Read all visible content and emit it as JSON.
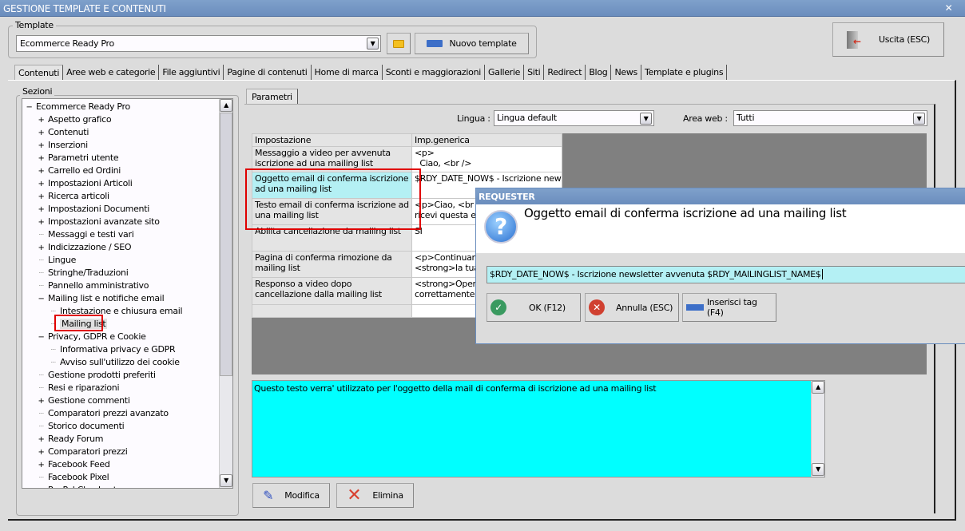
{
  "window": {
    "title": "GESTIONE TEMPLATE E CONTENUTI",
    "close": "✕"
  },
  "template": {
    "legend": "Template",
    "value": "Ecommerce Ready Pro",
    "new_label": "Nuovo template"
  },
  "exit_label": "Uscita (ESC)",
  "tabs": [
    "Contenuti",
    "Aree web e categorie",
    "File aggiuntivi",
    "Pagine di contenuti",
    "Home di marca",
    "Sconti e maggiorazioni",
    "Gallerie",
    "Siti",
    "Redirect",
    "Blog",
    "News",
    "Template e plugins"
  ],
  "sections": {
    "legend": "Sezioni",
    "items": [
      {
        "label": "Ecommerce Ready Pro",
        "level": 0,
        "toggle": "−"
      },
      {
        "label": "Aspetto grafico",
        "level": 1,
        "toggle": "+"
      },
      {
        "label": "Contenuti",
        "level": 1,
        "toggle": "+"
      },
      {
        "label": "Inserzioni",
        "level": 1,
        "toggle": "+"
      },
      {
        "label": "Parametri utente",
        "level": 1,
        "toggle": "+"
      },
      {
        "label": "Carrello ed Ordini",
        "level": 1,
        "toggle": "+"
      },
      {
        "label": "Impostazioni Articoli",
        "level": 1,
        "toggle": "+"
      },
      {
        "label": "Ricerca articoli",
        "level": 1,
        "toggle": "+"
      },
      {
        "label": "Impostazioni Documenti",
        "level": 1,
        "toggle": "+"
      },
      {
        "label": "Impostazioni avanzate sito",
        "level": 1,
        "toggle": "+"
      },
      {
        "label": "Messaggi e testi vari",
        "level": 1,
        "toggle": ""
      },
      {
        "label": "Indicizzazione / SEO",
        "level": 1,
        "toggle": "+"
      },
      {
        "label": "Lingue",
        "level": 1,
        "toggle": ""
      },
      {
        "label": "Stringhe/Traduzioni",
        "level": 1,
        "toggle": ""
      },
      {
        "label": "Pannello amministrativo",
        "level": 1,
        "toggle": ""
      },
      {
        "label": "Mailing list e notifiche email",
        "level": 1,
        "toggle": "−"
      },
      {
        "label": "Intestazione e chiusura email",
        "level": 2,
        "toggle": ""
      },
      {
        "label": "Mailing list",
        "level": 2,
        "toggle": "",
        "selected": true
      },
      {
        "label": "Privacy, GDPR e Cookie",
        "level": 1,
        "toggle": "−"
      },
      {
        "label": "Informativa privacy e GDPR",
        "level": 2,
        "toggle": ""
      },
      {
        "label": "Avviso sull'utilizzo dei cookie",
        "level": 2,
        "toggle": ""
      },
      {
        "label": "Gestione prodotti preferiti",
        "level": 1,
        "toggle": ""
      },
      {
        "label": "Resi e riparazioni",
        "level": 1,
        "toggle": ""
      },
      {
        "label": "Gestione commenti",
        "level": 1,
        "toggle": "+"
      },
      {
        "label": "Comparatori prezzi avanzato",
        "level": 1,
        "toggle": ""
      },
      {
        "label": "Storico documenti",
        "level": 1,
        "toggle": ""
      },
      {
        "label": "Ready Forum",
        "level": 1,
        "toggle": "+"
      },
      {
        "label": "Comparatori prezzi",
        "level": 1,
        "toggle": "+"
      },
      {
        "label": "Facebook Feed",
        "level": 1,
        "toggle": "+"
      },
      {
        "label": "Facebook Pixel",
        "level": 1,
        "toggle": ""
      },
      {
        "label": "PayPal Checkout",
        "level": 1,
        "toggle": ""
      }
    ]
  },
  "params": {
    "tab": "Parametri",
    "lingua_label": "Lingua :",
    "lingua_value": "Lingua default",
    "area_label": "Area web :",
    "area_value": "Tutti",
    "columns": [
      "Impostazione",
      "Imp.generica"
    ],
    "rows": [
      [
        "Messaggio a video per avvenuta iscrizione ad una mailing list",
        "<p>\n  Ciao, <br />"
      ],
      [
        "Oggetto email di conferma iscrizione ad una mailing list",
        "$RDY_DATE_NOW$ - Iscrizione newsletter avvenuta $RDY_MAILI"
      ],
      [
        "Testo email di conferma iscrizione ad una mailing list",
        "<p>Ciao, <br />\nricevi questa email"
      ],
      [
        "Abilita cancellazione da mailing list",
        "SI"
      ],
      [
        "Pagina di conferma rimozione da mailing list",
        "<p>Continuando\n<strong>la tua"
      ],
      [
        "Responso a video dopo cancellazione dalla mailing list",
        "<strong>Operazione\ncorrettamente! <"
      ],
      [
        "",
        ""
      ]
    ],
    "description": "Questo testo verra' utilizzato per l'oggetto della mail di conferma di iscrizione ad una mailing list",
    "edit_label": "Modifica",
    "delete_label": "Elimina"
  },
  "dialog": {
    "title": "REQUESTER",
    "question": "Oggetto email di conferma iscrizione ad una mailing list",
    "value": "$RDY_DATE_NOW$ - Iscrizione newsletter avvenuta $RDY_MAILINGLIST_NAME$",
    "ok": "OK (F12)",
    "cancel": "Annulla (ESC)",
    "insert": "Inserisci tag (F4)"
  }
}
